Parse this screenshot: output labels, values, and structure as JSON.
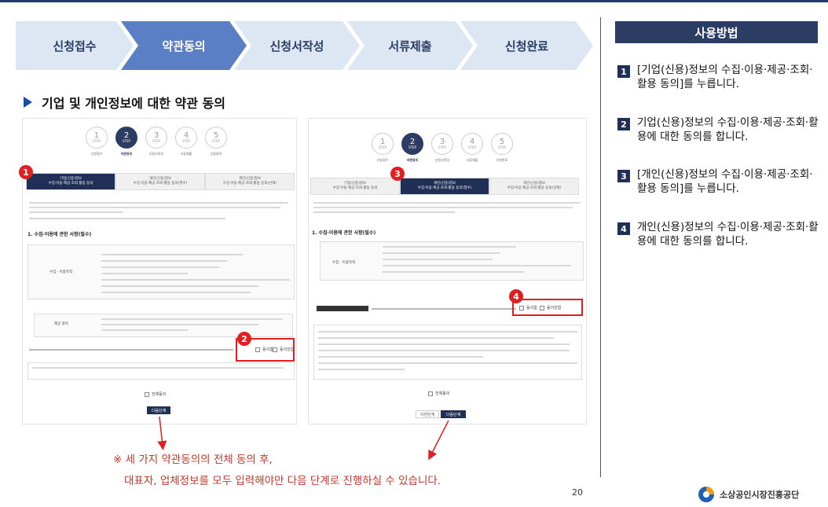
{
  "steps": [
    {
      "label": "신청접수",
      "active": false
    },
    {
      "label": "약관동의",
      "active": true
    },
    {
      "label": "신청서작성",
      "active": false
    },
    {
      "label": "서류제출",
      "active": false
    },
    {
      "label": "신청완료",
      "active": false
    }
  ],
  "section_title": "기업 및 개인정보에 대한 약관 동의",
  "mini_steps": [
    {
      "n": "1",
      "step": "STEP",
      "label": "신청접수"
    },
    {
      "n": "2",
      "step": "STEP",
      "label": "약관동의"
    },
    {
      "n": "3",
      "step": "STEP",
      "label": "신청서작성"
    },
    {
      "n": "4",
      "step": "STEP",
      "label": "서류제출"
    },
    {
      "n": "5",
      "step": "STEP",
      "label": "신청완료"
    }
  ],
  "left_shot": {
    "tabs": [
      [
        "기업(신용)정보",
        "수집·이용·제공·조회·활용 동의"
      ],
      [
        "개인(신용)정보",
        "수집·이용·제공·조회·활용 동의(필수)"
      ],
      [
        "개인(신용)정보",
        "수집·이용·제공·조회·활용 동의(선택)"
      ]
    ],
    "heading": "1. 수집·이용에 관한 사항(필수)",
    "row_label": "수집 · 이용목적",
    "row_label2": "제공 항목",
    "agree": "동의함",
    "disagree": "동의안함",
    "all_agree": "전체동의",
    "next": "다음단계"
  },
  "right_shot": {
    "tabs": [
      [
        "기업(신용)정보",
        "수집·이용·제공·조회·활용 동의"
      ],
      [
        "개인(신용)정보",
        "수집·이용·제공·조회·활용 동의(필수)"
      ],
      [
        "개인(신용)정보",
        "수집·이용·제공·조회·활용 동의(선택)"
      ]
    ],
    "heading": "1. 수집·이용에 관한 사항(필수)",
    "row_label": "수집 · 이용목적",
    "agree": "동의함",
    "disagree": "동의안함",
    "all_agree": "전체동의",
    "prev": "이전단계",
    "next": "다음단계"
  },
  "markers": [
    "1",
    "2",
    "3",
    "4"
  ],
  "note_line1": "※ 세 가지 약관동의의 전체 동의 후,",
  "note_line2": "대표자, 업체정보를 모두 입력해야만 다음 단계로 진행하실 수 있습니다.",
  "page_number": "20",
  "howto_title": "사용방법",
  "howto": [
    {
      "num": "1",
      "text": "[기업(신용)정보의 수집·이용·제공·조회·활용 동의]를 누릅니다."
    },
    {
      "num": "2",
      "text": "기업(신용)정보의 수집·이용·제공·조회·활용에 대한 동의를 합니다."
    },
    {
      "num": "3",
      "text": "[개인(신용)정보의 수집·이용·제공·조회·활용 동의]를 누릅니다."
    },
    {
      "num": "4",
      "text": "개인(신용)정보의 수집·이용·제공·조회·활용에 대한 동의를 합니다."
    }
  ],
  "logo_text": "소상공인시장진흥공단",
  "colors": {
    "navy": "#2b3d63",
    "accent_blue": "#5b7fc4",
    "light_step": "#dde6f3",
    "marker_red": "#e02020",
    "note_red": "#c0392b"
  }
}
